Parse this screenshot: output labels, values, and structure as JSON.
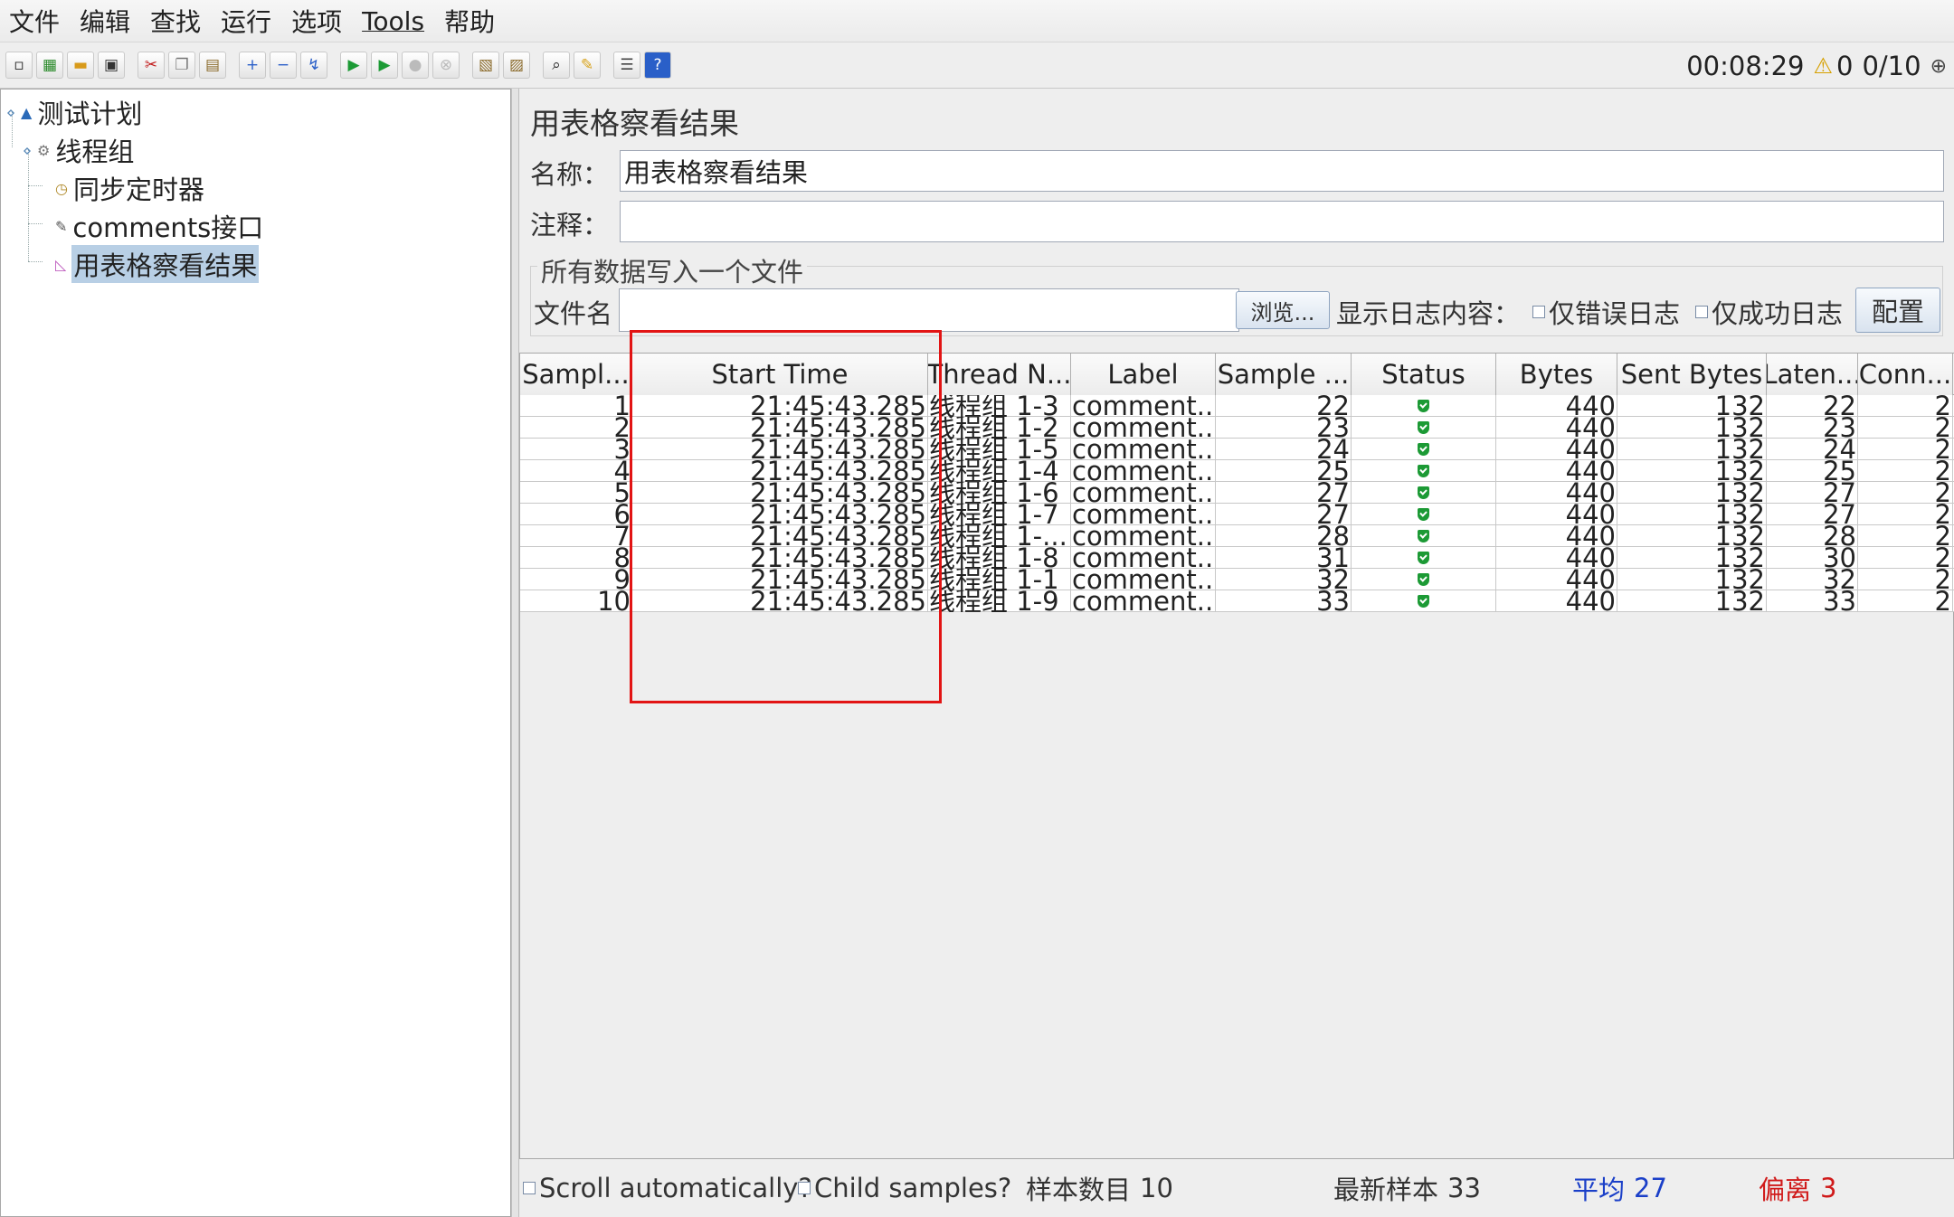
{
  "menu": [
    "文件",
    "编辑",
    "查找",
    "运行",
    "选项",
    "Tools",
    "帮助"
  ],
  "toolbar": {
    "elapsed": "00:08:29",
    "warning_count": "0",
    "thread_count": "0/10"
  },
  "tree": {
    "nodes": [
      {
        "label": "测试计划",
        "icon": "test-plan-icon"
      },
      {
        "label": "线程组",
        "icon": "thread-group-icon"
      },
      {
        "label": "同步定时器",
        "icon": "timer-icon"
      },
      {
        "label": "comments接口",
        "icon": "sampler-icon"
      },
      {
        "label": "用表格察看结果",
        "icon": "listener-icon"
      }
    ],
    "selected": "用表格察看结果"
  },
  "panel": {
    "title": "用表格察看结果",
    "name_label": "名称：",
    "name_value": "用表格察看结果",
    "comment_label": "注释：",
    "comment_value": "",
    "file_group_title": "所有数据写入一个文件",
    "filename_label": "文件名",
    "filename_value": "",
    "browse_button": "浏览...",
    "log_content_label": "显示日志内容：",
    "errors_only_label": "仅错误日志",
    "success_only_label": "仅成功日志",
    "configure_button": "配置"
  },
  "table": {
    "columns": [
      "Sampl...",
      "Start Time",
      "Thread N...",
      "Label",
      "Sample ...",
      "Status",
      "Bytes",
      "Sent Bytes",
      "Laten...",
      "Conn..."
    ],
    "rows": [
      [
        "1",
        "21:45:43.285",
        "线程组 1-3",
        "comment...",
        "22",
        "ok",
        "440",
        "132",
        "22",
        "2"
      ],
      [
        "2",
        "21:45:43.285",
        "线程组 1-2",
        "comment...",
        "23",
        "ok",
        "440",
        "132",
        "23",
        "2"
      ],
      [
        "3",
        "21:45:43.285",
        "线程组 1-5",
        "comment...",
        "24",
        "ok",
        "440",
        "132",
        "24",
        "2"
      ],
      [
        "4",
        "21:45:43.285",
        "线程组 1-4",
        "comment...",
        "25",
        "ok",
        "440",
        "132",
        "25",
        "2"
      ],
      [
        "5",
        "21:45:43.285",
        "线程组 1-6",
        "comment...",
        "27",
        "ok",
        "440",
        "132",
        "27",
        "2"
      ],
      [
        "6",
        "21:45:43.285",
        "线程组 1-7",
        "comment...",
        "27",
        "ok",
        "440",
        "132",
        "27",
        "2"
      ],
      [
        "7",
        "21:45:43.285",
        "线程组 1-...",
        "comment...",
        "28",
        "ok",
        "440",
        "132",
        "28",
        "2"
      ],
      [
        "8",
        "21:45:43.285",
        "线程组 1-8",
        "comment...",
        "31",
        "ok",
        "440",
        "132",
        "30",
        "2"
      ],
      [
        "9",
        "21:45:43.285",
        "线程组 1-1",
        "comment...",
        "32",
        "ok",
        "440",
        "132",
        "32",
        "2"
      ],
      [
        "10",
        "21:45:43.285",
        "线程组 1-9",
        "comment...",
        "33",
        "ok",
        "440",
        "132",
        "33",
        "2"
      ]
    ],
    "status_ok_color": "#1c9a35"
  },
  "footer": {
    "scroll_label": "Scroll automatically?",
    "child_label": "Child samples?",
    "sample_count_label": "样本数目",
    "sample_count_value": "10",
    "latest_label": "最新样本",
    "latest_value": "33",
    "average_label": "平均",
    "average_value": "27",
    "deviation_label": "偏离",
    "deviation_value": "3"
  },
  "colors": {
    "highlight": "#e21414",
    "average": "#1a3fc8",
    "deviation": "#d01a1a",
    "selection": "#b8cfe5"
  }
}
